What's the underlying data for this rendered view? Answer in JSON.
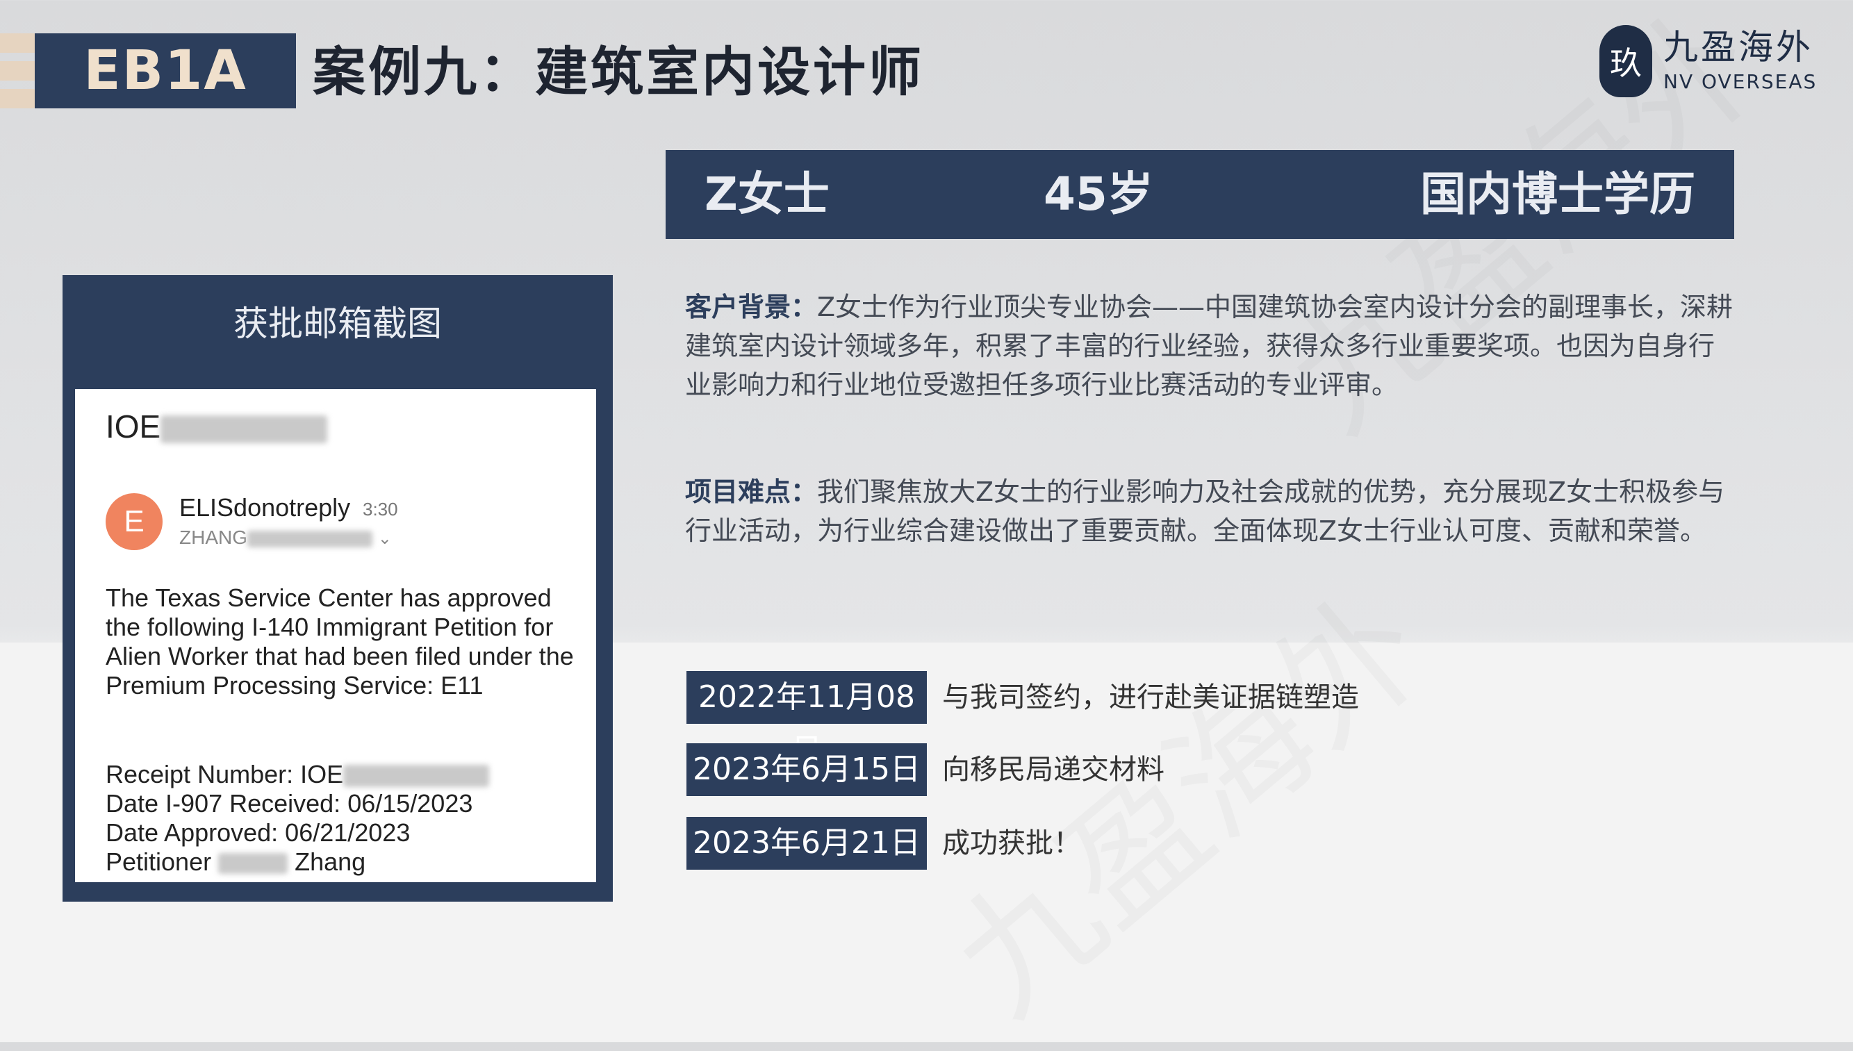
{
  "header": {
    "tag": "EB1A",
    "title": "案例九：建筑室内设计师"
  },
  "logo": {
    "mark": "玖",
    "name_cn": "九盈海外",
    "name_en": "NV OVERSEAS"
  },
  "profile": {
    "name": "Z女士",
    "age": "45岁",
    "education": "国内博士学历"
  },
  "email_panel": {
    "title": "获批邮箱截图",
    "subject_prefix": "IOE",
    "avatar_letter": "E",
    "sender": "ELISdonotreply",
    "time": "3:30",
    "recipient_prefix": "ZHANG",
    "body": "The Texas Service Center has approved the following I-140 Immigrant Petition for Alien Worker that had been filed under the Premium Processing Service: E11",
    "receipt_label": "Receipt Number: IOE",
    "date_received": "Date I-907 Received: 06/15/2023",
    "date_approved": "Date Approved: 06/21/2023",
    "petitioner_label": "Petitioner",
    "petitioner_surname": "Zhang"
  },
  "background": {
    "label": "客户背景：",
    "text": "Z女士作为行业顶尖专业协会——中国建筑协会室内设计分会的副理事长，深耕建筑室内设计领域多年，积累了丰富的行业经验，获得众多行业重要奖项。也因为自身行业影响力和行业地位受邀担任多项行业比赛活动的专业评审。"
  },
  "difficulty": {
    "label": "项目难点：",
    "text": "我们聚焦放大Z女士的行业影响力及社会成就的优势，充分展现Z女士积极参与行业活动，为行业综合建设做出了重要贡献。全面体现Z女士行业认可度、贡献和荣誉。"
  },
  "timeline": [
    {
      "date": "2022年11月08日",
      "event": "与我司签约，进行赴美证据链塑造"
    },
    {
      "date": "2023年6月15日",
      "event": "向移民局递交材料"
    },
    {
      "date": "2023年6月21日",
      "event": "成功获批！"
    }
  ],
  "colors": {
    "navy": "#2c3e5c",
    "beige": "#e6d4c0",
    "avatar": "#f0845f"
  }
}
